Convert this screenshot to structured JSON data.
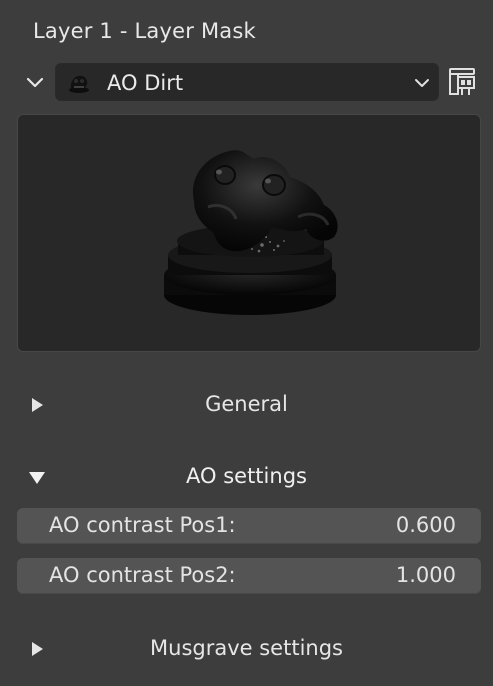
{
  "panel": {
    "title": "Layer 1 - Layer Mask"
  },
  "selector": {
    "value": "AO Dirt",
    "thumb_icon": "ao-dirt-material-thumbnail",
    "dropdown_icon": "chevron-down-icon",
    "browse_icon": "browse-texture-icon"
  },
  "preview": {
    "icon": "material-preview-image"
  },
  "sections": {
    "general": {
      "label": "General",
      "expanded": false
    },
    "ao_settings": {
      "label": "AO settings",
      "expanded": true
    },
    "musgrave": {
      "label": "Musgrave settings",
      "expanded": false
    }
  },
  "properties": {
    "ao_contrast_pos1": {
      "label": "AO contrast Pos1:",
      "value": "0.600"
    },
    "ao_contrast_pos2": {
      "label": "AO contrast Pos2:",
      "value": "1.000"
    }
  },
  "colors": {
    "panel_bg": "#3d3d3d",
    "field_dark": "#282828",
    "field_light": "#545454",
    "text": "#e6e6e6"
  }
}
